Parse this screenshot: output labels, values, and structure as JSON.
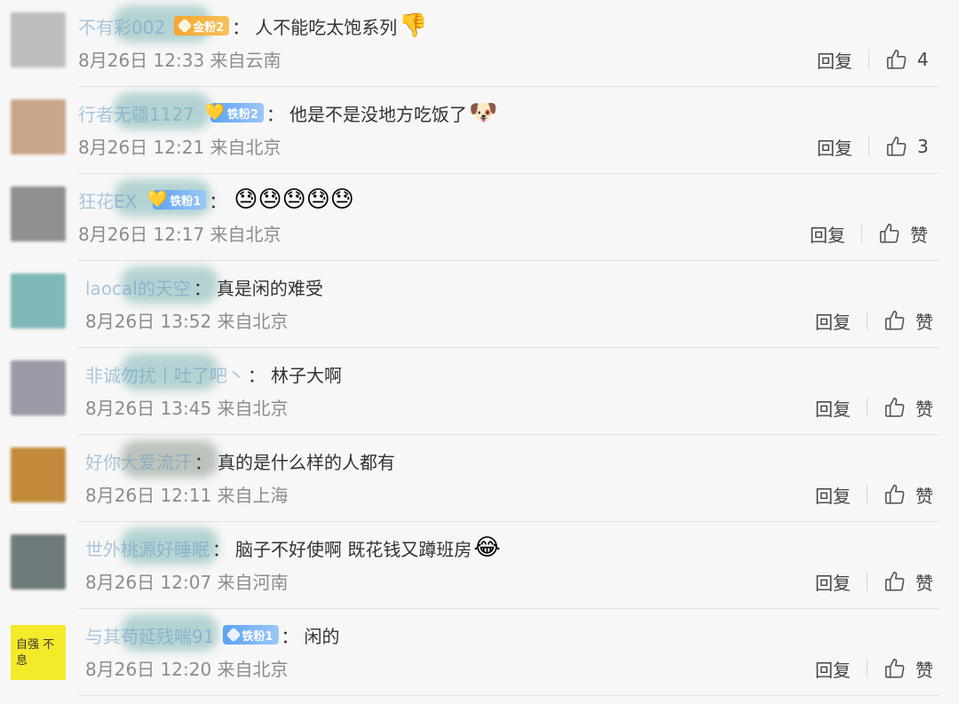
{
  "labels": {
    "reply": "回复",
    "like": "赞"
  },
  "comments": [
    {
      "username": "不有彩002",
      "badge": {
        "type": "gold",
        "text": "金粉2"
      },
      "text": "人不能吃太饱系列",
      "emoji": "👎",
      "time": "8月26日 12:33",
      "location": "来自云南",
      "likes": "4",
      "avatar_color": "#bdbdbd"
    },
    {
      "username": "行者无疆1127",
      "badge": {
        "type": "iron-heart",
        "text": "铁粉2"
      },
      "text": "他是不是没地方吃饭了",
      "emoji": "🐶",
      "time": "8月26日 12:21",
      "location": "来自北京",
      "likes": "3",
      "avatar_color": "#c9a58a"
    },
    {
      "username": "狂花EX",
      "badge": {
        "type": "iron-heart",
        "text": "铁粉1"
      },
      "text": "",
      "emoji": "😓😓😓😓😓",
      "time": "8月26日 12:17",
      "location": "来自北京",
      "likes": "赞",
      "avatar_color": "#8f8f8f"
    },
    {
      "username": "laocal的天空",
      "badge": null,
      "text": "真是闲的难受",
      "emoji": "",
      "time": "8月26日 13:52",
      "location": "来自北京",
      "likes": "赞",
      "avatar_color": "#7fb8b8"
    },
    {
      "username": "非诚勿扰丨吐了吧丶",
      "badge": null,
      "text": "林子大啊",
      "emoji": "",
      "time": "8月26日 13:45",
      "location": "来自北京",
      "likes": "赞",
      "avatar_color": "#9a9aa8"
    },
    {
      "username": "好你大爱流汗",
      "badge": null,
      "text": "真的是什么样的人都有",
      "emoji": "",
      "time": "8月26日 12:11",
      "location": "来自上海",
      "likes": "赞",
      "avatar_color": "#c28a3a"
    },
    {
      "username": "世外桃源好睡眠",
      "badge": null,
      "text": "脑子不好使啊 既花钱又蹲班房",
      "emoji": "😂",
      "time": "8月26日 12:07",
      "location": "来自河南",
      "likes": "赞",
      "avatar_color": "#6f7a7a"
    },
    {
      "username": "与其苟延残喘91",
      "badge": {
        "type": "iron",
        "text": "铁粉1"
      },
      "text": "闲的",
      "emoji": "",
      "time": "8月26日 12:20",
      "location": "来自北京",
      "likes": "赞",
      "avatar_color": "#f3ea2a",
      "avatar_text": "自强 不息"
    }
  ]
}
